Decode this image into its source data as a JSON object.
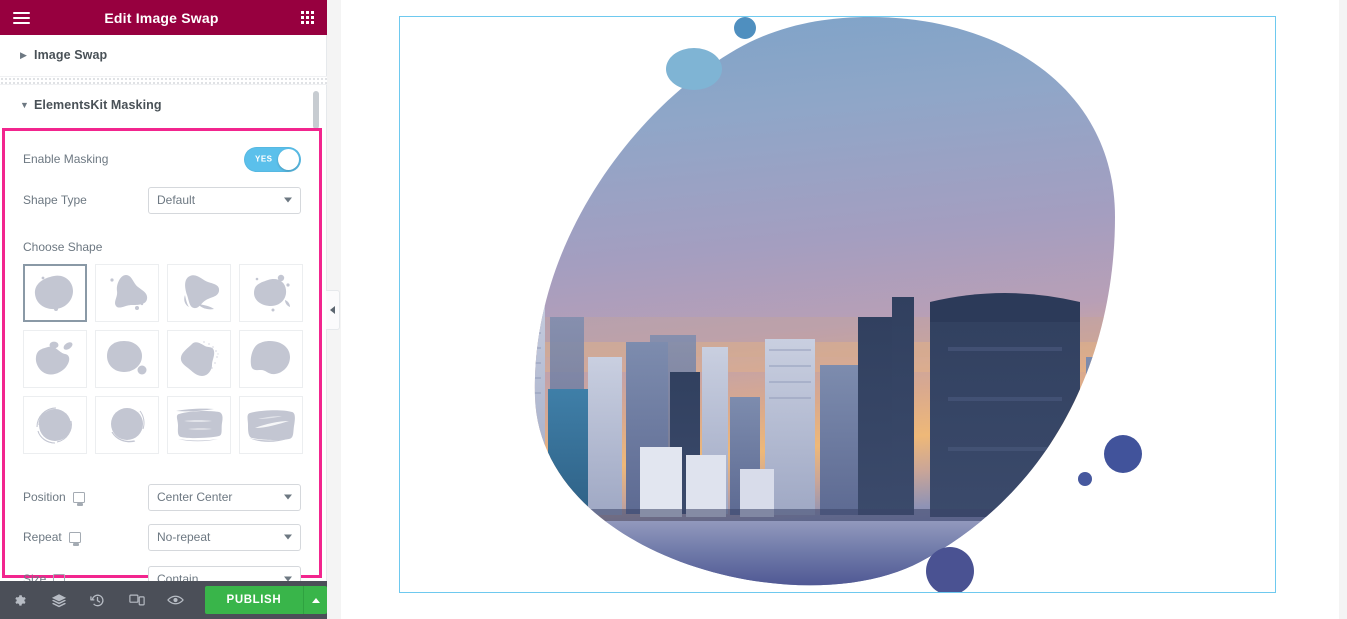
{
  "panel": {
    "header": {
      "title": "Edit Image Swap",
      "menu_icon": "hamburger-icon",
      "apps_icon": "grid-icon"
    },
    "sections": [
      {
        "title": "Image Swap",
        "expanded": false,
        "caret": "▶"
      },
      {
        "title": "ElementsKit Masking",
        "expanded": true,
        "caret": "▼"
      }
    ],
    "masking": {
      "enable": {
        "label": "Enable Masking",
        "toggle_text": "YES",
        "value": true
      },
      "shape_type": {
        "label": "Shape Type",
        "value": "Default"
      },
      "choose_shape": {
        "label": "Choose Shape",
        "selected_index": 0,
        "shapes": [
          "blob-rounded-1",
          "blob-triangle-2",
          "blob-fan-3",
          "blob-splash-4",
          "blob-bean-5",
          "blob-drop-6",
          "blob-noise-7",
          "blob-wave-8",
          "circle-sketch-9",
          "circle-brush-10",
          "brush-stroke-11",
          "brush-swipe-12"
        ]
      },
      "position": {
        "label": "Position",
        "value": "Center Center",
        "device": "desktop"
      },
      "repeat": {
        "label": "Repeat",
        "value": "No-repeat",
        "device": "desktop"
      },
      "size": {
        "label": "Size",
        "value": "Contain",
        "device": "desktop"
      }
    }
  },
  "bottom_bar": {
    "icons": [
      {
        "name": "settings-icon",
        "glyph": "⚙"
      },
      {
        "name": "navigator-layers-icon",
        "glyph": "☲"
      },
      {
        "name": "history-icon",
        "glyph": "↺"
      },
      {
        "name": "responsive-mode-icon",
        "glyph": "▭"
      },
      {
        "name": "preview-eye-icon",
        "glyph": "◉"
      }
    ],
    "publish": {
      "label": "PUBLISH",
      "caret": "▲"
    }
  },
  "collapse_handle": {
    "name": "panel-collapse-handle",
    "glyph": "‹"
  },
  "canvas": {
    "image_alt": "City skyline at sunset masked with organic blob shape",
    "decor_circles": [
      {
        "name": "decor-circle-top-small",
        "color": "#4f8fbf"
      },
      {
        "name": "decor-circle-top-large",
        "color": "#7fb4d4"
      },
      {
        "name": "decor-circle-right-large",
        "color": "#41539b"
      },
      {
        "name": "decor-circle-right-small",
        "color": "#46589e"
      },
      {
        "name": "decor-circle-bottom",
        "color": "#4a5292"
      }
    ]
  },
  "colors": {
    "header_bg": "#97003f",
    "highlight_border": "#f2258e",
    "toggle_on": "#5bc0eb",
    "publish_green": "#39b54a",
    "bottom_bar": "#4b4f58",
    "canvas_border": "#6ec9ef",
    "shape_fill": "#c3c6d2"
  }
}
